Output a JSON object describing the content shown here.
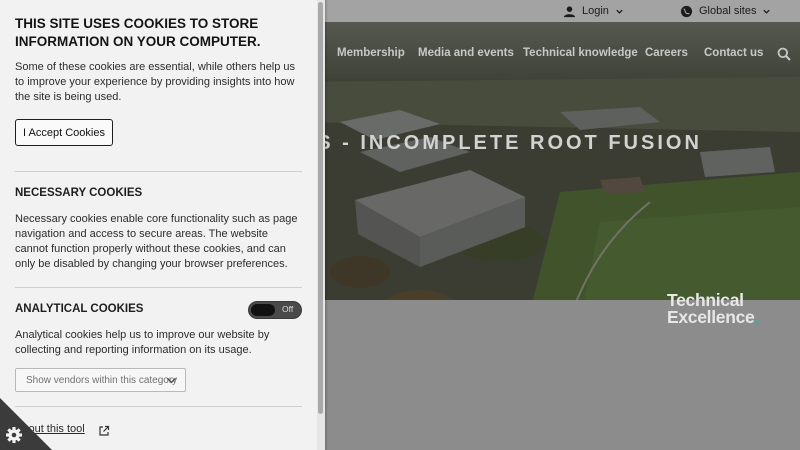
{
  "topbar": {
    "login_label": "Login",
    "global_label": "Global sites",
    "icons": {
      "login": "user-icon",
      "global": "globe-icon",
      "caret": "chevron-down-icon"
    }
  },
  "nav": {
    "items": [
      "Membership",
      "Media and events",
      "Technical knowledge",
      "Careers",
      "Contact us"
    ],
    "search_icon": "search-icon"
  },
  "hero": {
    "title": "CTIONS - INCOMPLETE ROOT FUSION",
    "logo_line1": "Technical",
    "logo_line2": "Excellence",
    "logo_dot": ".",
    "accent_color": "#2bb5a0"
  },
  "cookie_panel": {
    "title": "THIS SITE USES COOKIES TO STORE INFORMATION ON YOUR COMPUTER.",
    "intro": "Some of these cookies are essential, while others help us to improve your experience by providing insights into how the site is being used.",
    "accept_label": "I Accept Cookies",
    "necessary": {
      "heading": "NECESSARY COOKIES",
      "text": "Necessary cookies enable core functionality such as page navigation and access to secure areas. The website cannot function properly without these cookies, and can only be disabled by changing your browser preferences."
    },
    "analytical": {
      "heading": "ANALYTICAL COOKIES",
      "toggle_label": "Off",
      "text": "Analytical cookies help us to improve our website by collecting and reporting information on its usage.",
      "vendors_label": "Show vendors within this category"
    },
    "about_label": "About this tool",
    "icons": {
      "external": "external-link-icon",
      "settings": "gear-icon"
    }
  }
}
